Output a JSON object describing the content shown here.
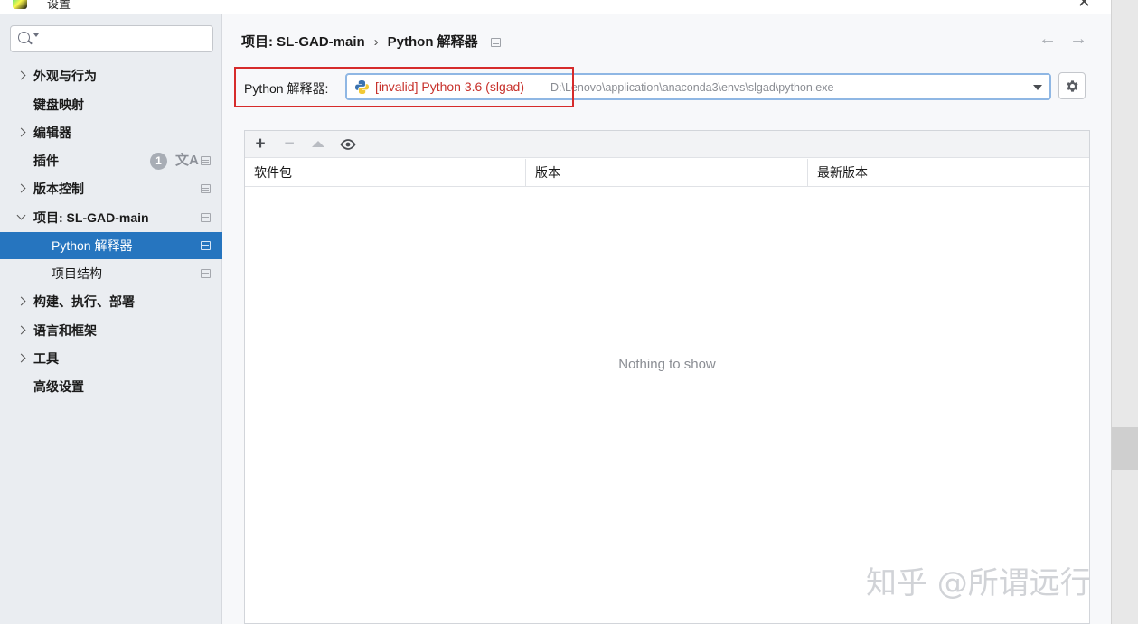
{
  "window": {
    "title": "设置"
  },
  "sidebar": {
    "search": {
      "placeholder": ""
    },
    "items": [
      {
        "label": "外观与行为",
        "expandable": true
      },
      {
        "label": "键盘映射",
        "expandable": false
      },
      {
        "label": "编辑器",
        "expandable": true
      },
      {
        "label": "插件",
        "expandable": false,
        "badge": "1",
        "translate_icon": "文A"
      },
      {
        "label": "版本控制",
        "expandable": true
      },
      {
        "label": "项目: SL-GAD-main",
        "expandable": true,
        "expanded": true
      },
      {
        "label": "Python 解释器",
        "sub": true,
        "selected": true
      },
      {
        "label": "项目结构",
        "sub": true
      },
      {
        "label": "构建、执行、部署",
        "expandable": true
      },
      {
        "label": "语言和框架",
        "expandable": true
      },
      {
        "label": "工具",
        "expandable": true
      },
      {
        "label": "高级设置",
        "expandable": false
      }
    ]
  },
  "breadcrumb": {
    "project": "项目: SL-GAD-main",
    "separator": "›",
    "page": "Python 解释器"
  },
  "nav": {
    "back": "←",
    "forward": "→"
  },
  "interpreter": {
    "label": "Python 解释器:",
    "value_invalid": "[invalid] Python 3.6 (slgad)",
    "path": "D:\\Lenovo\\application\\anaconda3\\envs\\slgad\\python.exe",
    "accent_color": "#c7312b"
  },
  "packages": {
    "toolbar": {
      "add": "+",
      "remove": "−",
      "eye": "👁"
    },
    "columns": [
      "软件包",
      "版本",
      "最新版本"
    ],
    "empty_text": "Nothing to show"
  },
  "watermark": "知乎 @所谓远行",
  "colors": {
    "selection": "#2675bf",
    "sidebar_bg": "#eaedf1",
    "highlight_border": "#d62b2b"
  }
}
